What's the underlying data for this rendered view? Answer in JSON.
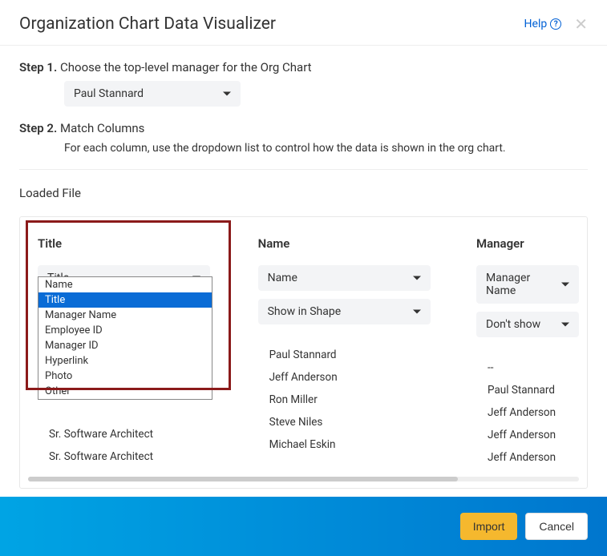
{
  "header": {
    "title": "Organization Chart Data Visualizer",
    "help": "Help"
  },
  "step1": {
    "label_bold": "Step 1.",
    "label_rest": " Choose the top-level manager for the Org Chart",
    "selected": "Paul Stannard"
  },
  "step2": {
    "label_bold": "Step 2.",
    "label_rest": " Match Columns",
    "desc": "For each column, use the dropdown list to control how the data is shown in the org chart."
  },
  "loaded_file": "Loaded File",
  "columns": {
    "col1": {
      "header": "Title",
      "select1": "Title",
      "rows": [
        "Sr. Software Architect",
        "Sr. Software Architect"
      ]
    },
    "col2": {
      "header": "Name",
      "select1": "Name",
      "select2": "Show in Shape",
      "rows": [
        "Paul Stannard",
        "Jeff Anderson",
        "Ron Miller",
        "Steve Niles",
        "Michael Eskin"
      ]
    },
    "col3": {
      "header": "Manager",
      "select1": "Manager Name",
      "select2": "Don't show",
      "rows": [
        "--",
        "Paul Stannard",
        "Jeff Anderson",
        "Jeff Anderson",
        "Jeff Anderson"
      ]
    }
  },
  "dropdown": {
    "options": [
      "Name",
      "Title",
      "Manager Name",
      "Employee ID",
      "Manager ID",
      "Hyperlink",
      "Photo",
      "Other"
    ],
    "selected": "Title"
  },
  "footer": {
    "import": "Import",
    "cancel": "Cancel"
  }
}
